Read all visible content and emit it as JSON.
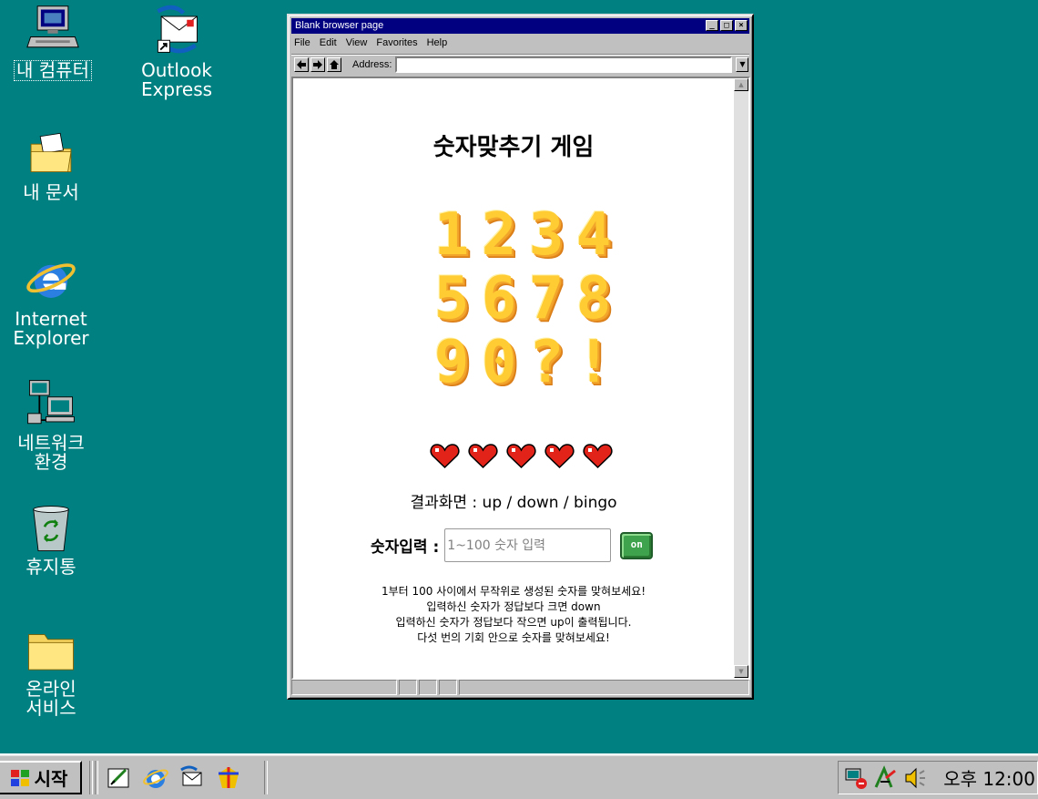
{
  "desktop": {
    "icons": [
      {
        "label": "내 컴퓨터",
        "icon": "my-computer-icon"
      },
      {
        "label": "Outlook\nExpress",
        "icon": "outlook-express-icon"
      },
      {
        "label": "내 문서",
        "icon": "my-documents-icon"
      },
      {
        "label": "Internet\nExplorer",
        "icon": "internet-explorer-icon"
      },
      {
        "label": "네트워크\n환경",
        "icon": "network-neighborhood-icon"
      },
      {
        "label": "휴지통",
        "icon": "recycle-bin-icon"
      },
      {
        "label": "온라인\n서비스",
        "icon": "online-services-icon"
      }
    ]
  },
  "browser": {
    "title": "Blank browser page",
    "title_buttons": [
      "_",
      "□",
      "×"
    ],
    "menu": [
      "File",
      "Edit",
      "View",
      "Favorites",
      "Help"
    ],
    "address_label": "Address:",
    "address_value": "",
    "page": {
      "title": "숫자맞추기 게임",
      "pixel_rows": [
        [
          "1",
          "2",
          "3",
          "4"
        ],
        [
          "5",
          "6",
          "7",
          "8"
        ],
        [
          "9",
          "0",
          "?",
          "!"
        ]
      ],
      "lives": 5,
      "heart_color": "#e2231a",
      "result_text": "결과화면 : up / down / bingo",
      "input_label": "숫자입력 :",
      "input_placeholder": "1~100 숫자 입력",
      "go_button": "on",
      "instructions": [
        "1부터 100 사이에서 무작위로 생성된 숫자를 맞혀보세요!",
        "입력하신 숫자가 정답보다 크면 down",
        "입력하신 숫자가 정답보다 작으면 up이 출력됩니다.",
        "다섯 번의 기회 안으로 숫자를 맞혀보세요!"
      ]
    }
  },
  "taskbar": {
    "start_label": "시작",
    "quick_launch": [
      "show-desktop-icon",
      "internet-explorer-icon",
      "outlook-express-icon",
      "channels-icon"
    ],
    "tray_icons": [
      "network-tray-icon",
      "ime-tray-icon",
      "volume-tray-icon"
    ],
    "clock": "오후 12:00"
  },
  "colors": {
    "desktop": "#008080",
    "titlebar": "#000080",
    "window": "#c0c0c0",
    "digit_yellow": "#ffcc33",
    "digit_shadow": "#e58a1f",
    "go_button_green": "#3fa34d"
  }
}
